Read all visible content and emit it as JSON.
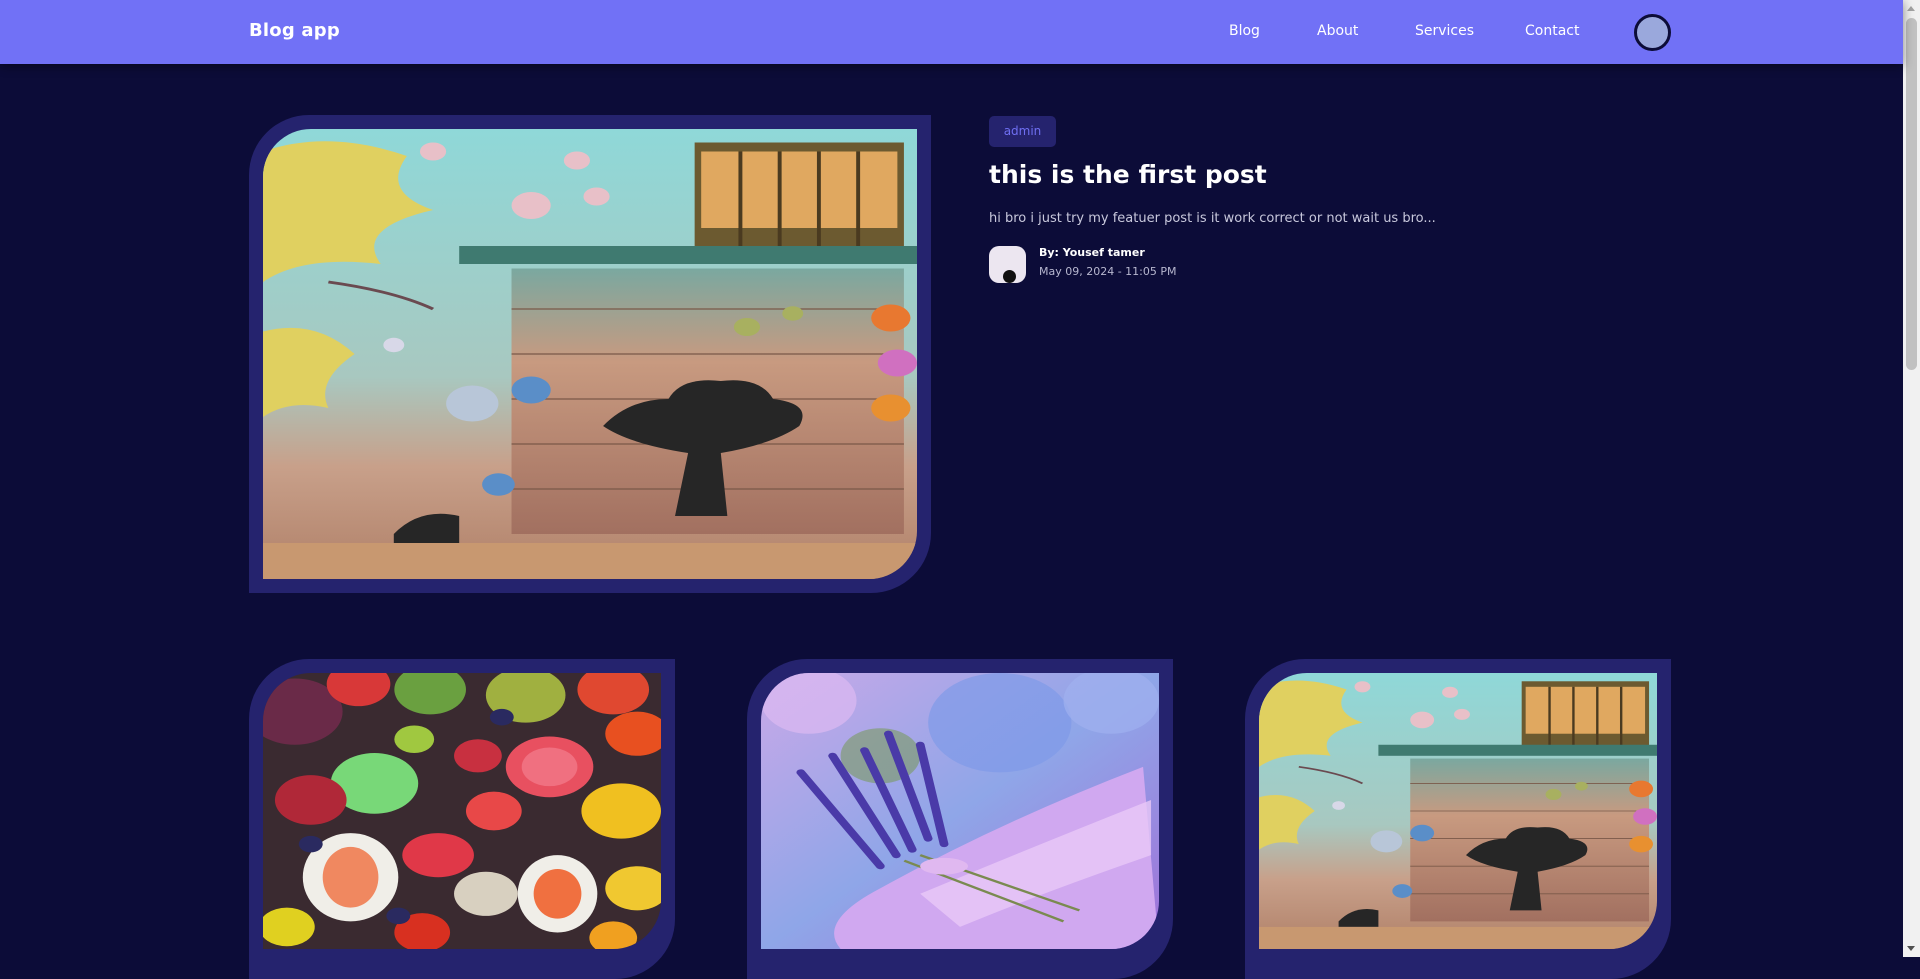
{
  "navbar": {
    "brand": "Blog app",
    "links": [
      "Blog",
      "About",
      "Services",
      "Contact"
    ],
    "avatar_icon": "user-avatar-icon"
  },
  "featured": {
    "tag": "admin",
    "title": "this is the first post",
    "excerpt": "hi bro i just try my featuer post is it work correct or not wait us bro...",
    "author": "By: Yousef tamer",
    "date": "May 09, 2024 - 11:05 PM",
    "image": "graffiti-wall-mural"
  },
  "posts": [
    {
      "image": "fruit-pile-photo"
    },
    {
      "image": "lavender-bouquet-photo"
    },
    {
      "image": "graffiti-wall-mural"
    }
  ],
  "colors": {
    "navbar_bg": "#7171f6",
    "page_bg": "#0c0c38",
    "frame_bg": "#25236e",
    "badge_text": "#6f6ff2"
  }
}
